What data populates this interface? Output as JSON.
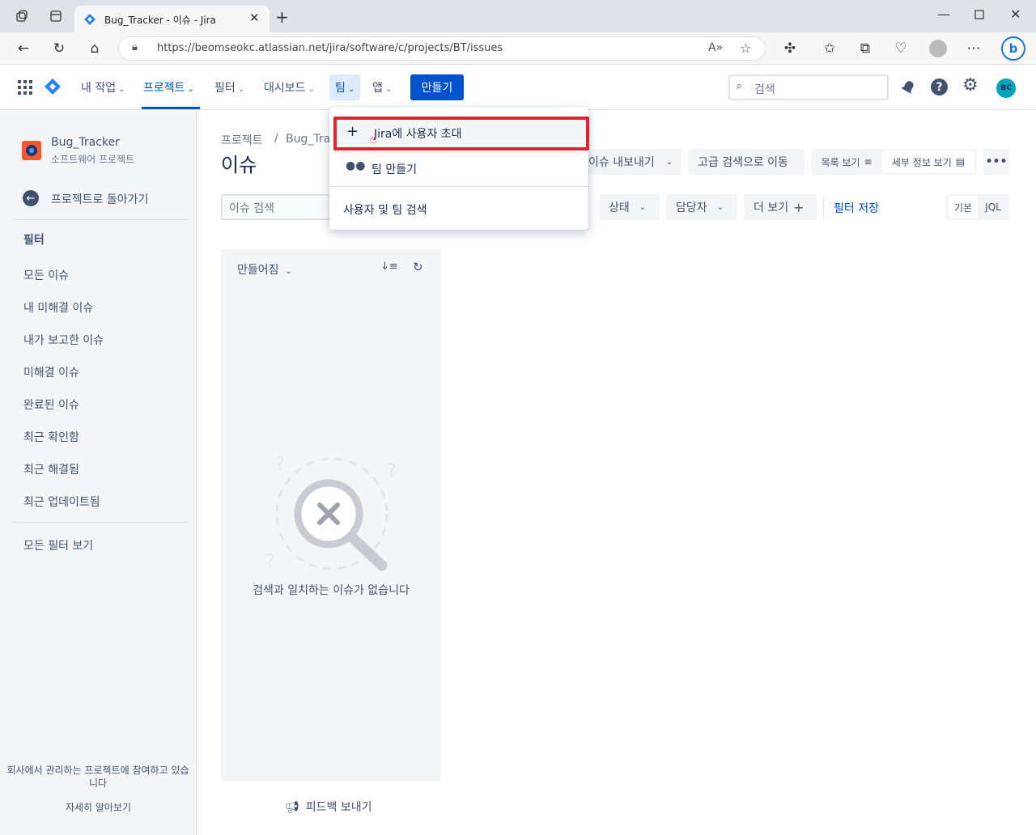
{
  "browser": {
    "tab_title": "Bug_Tracker - 이슈 - Jira",
    "url": "https://beomseokc.atlassian.net/jira/software/c/projects/BT/issues"
  },
  "topnav": {
    "your_work": "내 작업",
    "projects": "프로젝트",
    "filters": "필터",
    "dashboards": "대시보드",
    "teams": "팀",
    "apps": "앱",
    "create": "만들기",
    "search_placeholder": "검색",
    "avatar_initials": "BC"
  },
  "teams_menu": {
    "invite": "Jira에 사용자 초대",
    "create_team": "팀 만들기",
    "search_people": "사용자 및 팀 검색"
  },
  "sidebar": {
    "project_name": "Bug_Tracker",
    "project_type": "소프트웨어 프로젝트",
    "back": "프로젝트로 돌아가기",
    "filters_heading": "필터",
    "items": [
      "모든 이슈",
      "내 미해결 이슈",
      "내가 보고한 이슈",
      "미해결 이슈",
      "완료된 이슈",
      "최근 확인함",
      "최근 해결됨",
      "최근 업데이트됨"
    ],
    "all_filters": "모든 필터 보기",
    "footer_note": "회사에서 관리하는 프로젝트에 참여하고 있습니다",
    "learn_more": "자세히 알아보기"
  },
  "main": {
    "breadcrumb_root": "프로젝트",
    "breadcrumb_sep": "/",
    "breadcrumb_project": "Bug_Trac",
    "title": "이슈",
    "export": "이슈 내보내기",
    "advanced_search": "고급 검색으로 이동",
    "list_view": "목록 보기",
    "detail_view": "세부 정보 보기",
    "search_placeholder": "이슈 검색",
    "status": "상태",
    "assignee": "담당자",
    "more": "더 보기",
    "save_filter": "필터 저장",
    "basic": "기본",
    "jql": "JQL",
    "sort_label": "만들어짐",
    "empty_message": "검색과 일치하는 이슈가 없습니다",
    "feedback": "피드백 보내기"
  },
  "colors": {
    "jira_blue": "#0052cc",
    "highlight_red": "#e0242d",
    "avatar_teal": "#00a3bf"
  }
}
